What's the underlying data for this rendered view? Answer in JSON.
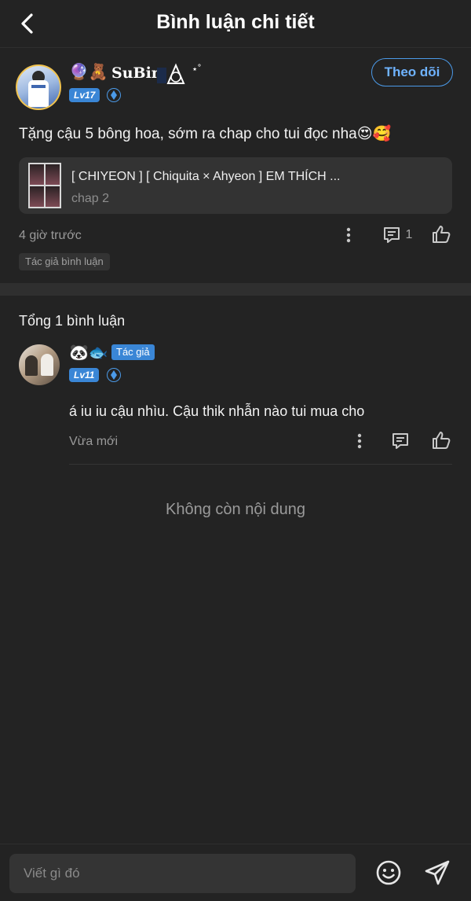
{
  "header": {
    "title": "Bình luận chi tiết",
    "back_icon": "chevron-left-icon"
  },
  "comment": {
    "username": "SuBin",
    "emoji_prefix": "🔮🧸",
    "name_suffix": "⋆˚",
    "level": "Lv17",
    "follow_label": "Theo dõi",
    "text": "Tặng cậu 5 bông hoa, sớm ra chap cho tui đọc nha😍🥰",
    "chapter": {
      "title": "[ CHIYEON ] [ Chiquita × Ahyeon ] EM THÍCH ...",
      "subtitle": "chap 2"
    },
    "time": "4 giờ trước",
    "reply_count": "1",
    "tag": "Tác giả bình luận"
  },
  "total_label": "Tổng 1 bình luận",
  "reply": {
    "username_emoji": "🐼🐟",
    "author_badge": "Tác giả",
    "level": "Lv11",
    "text": "á iu iu cậu nhìu. Cậu thik nhẫn nào tui mua cho",
    "time": "Vừa mới"
  },
  "end_label": "Không còn nội dung",
  "input": {
    "placeholder": "Viết gì đó"
  },
  "colors": {
    "background": "#232323",
    "accent": "#4b9ae8",
    "badge": "#3a86d6"
  }
}
